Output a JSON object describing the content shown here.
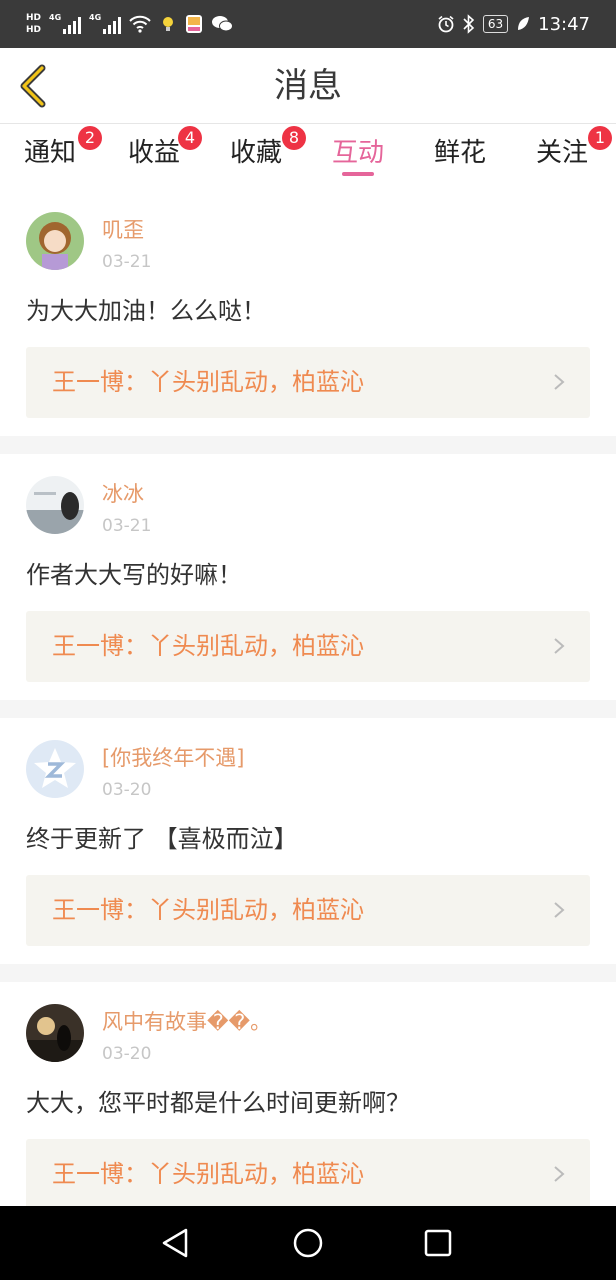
{
  "status_bar": {
    "hd1": "HD",
    "hd2": "HD",
    "net1": "4G",
    "net2": "4G",
    "battery": "63",
    "time": "13:47"
  },
  "header": {
    "title": "消息"
  },
  "tabs": [
    {
      "label": "通知",
      "badge": "2"
    },
    {
      "label": "收益",
      "badge": "4"
    },
    {
      "label": "收藏",
      "badge": "8"
    },
    {
      "label": "互动",
      "badge": ""
    },
    {
      "label": "鲜花",
      "badge": ""
    },
    {
      "label": "关注",
      "badge": "1"
    }
  ],
  "active_tab": "互动",
  "messages": [
    {
      "user": "叽歪",
      "date": "03-21",
      "text": "为大大加油！么么哒！",
      "quote": "王一博：丫头别乱动，柏蓝沁"
    },
    {
      "user": "冰冰",
      "date": "03-21",
      "text": "作者大大写的好嘛！",
      "quote": "王一博：丫头别乱动，柏蓝沁"
    },
    {
      "user": "[你我终年不遇]",
      "date": "03-20",
      "text": "终于更新了 【喜极而泣】",
      "quote": "王一博：丫头别乱动，柏蓝沁"
    },
    {
      "user": "风中有故事��。",
      "date": "03-20",
      "text": "大大，您平时都是什么时间更新啊？",
      "quote": "王一博：丫头别乱动，柏蓝沁"
    }
  ],
  "colors": {
    "accent_pink": "#e5659a",
    "username_orange": "#e69a6a",
    "quote_orange": "#ef8a50",
    "badge_red": "#ee3344"
  }
}
